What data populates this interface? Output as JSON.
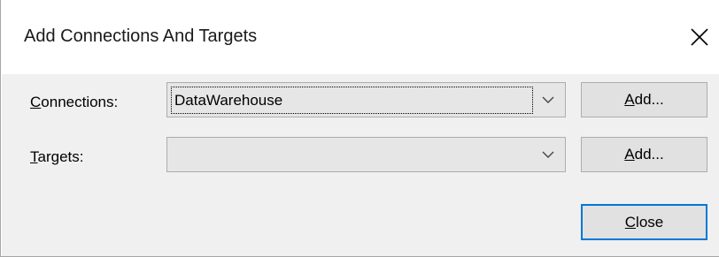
{
  "dialog": {
    "title": "Add Connections And Targets"
  },
  "connections": {
    "label_mnemonic": "C",
    "label_rest": "onnections:",
    "selected_value": "DataWarehouse",
    "add_mnemonic": "A",
    "add_rest": "dd..."
  },
  "targets": {
    "label_mnemonic": "T",
    "label_rest": "argets:",
    "selected_value": "",
    "add_mnemonic": "A",
    "add_rest": "dd..."
  },
  "footer": {
    "close_mnemonic": "C",
    "close_rest": "lose"
  },
  "icons": {
    "close": "close-icon",
    "dropdown": "chevron-down-icon"
  },
  "colors": {
    "client_bg": "#f0f0f0",
    "button_bg": "#e1e1e1",
    "default_button_border": "#0078d7"
  }
}
